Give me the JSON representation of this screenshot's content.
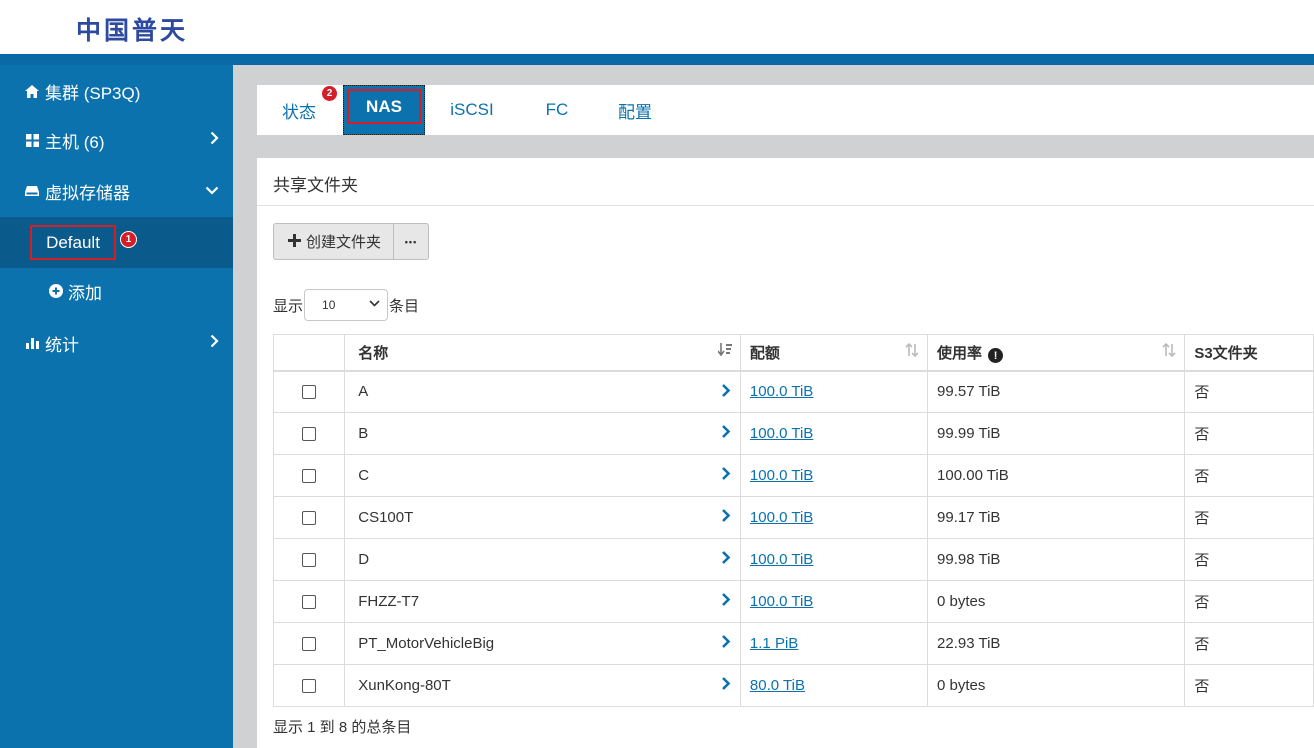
{
  "header": {
    "logo": "中国普天"
  },
  "sidebar": {
    "cluster": {
      "label": "集群 (SP3Q)",
      "icon": "home-icon"
    },
    "hosts": {
      "label": "主机 (6)",
      "icon": "grid-icon"
    },
    "storage": {
      "label": "虚拟存储器",
      "icon": "drive-icon"
    },
    "default": {
      "label": "Default",
      "badge": "1"
    },
    "add": {
      "label": "添加",
      "icon": "plus-circle-icon"
    },
    "stats": {
      "label": "统计",
      "icon": "bar-chart-icon"
    }
  },
  "tabs": {
    "status": "状态",
    "nas": "NAS",
    "iscsi": "iSCSI",
    "fc": "FC",
    "config": "配置",
    "badge": "2"
  },
  "panel": {
    "title": "共享文件夹"
  },
  "toolbar": {
    "create_label": "创建文件夹",
    "more_label": "•••"
  },
  "length": {
    "prefix": "显示",
    "value": "10",
    "suffix": "条目"
  },
  "table": {
    "headers": {
      "name": "名称",
      "quota": "配额",
      "usage": "使用率",
      "s3": "S3文件夹"
    },
    "rows": [
      {
        "name": "A",
        "quota": "100.0 TiB",
        "usage": "99.57 TiB",
        "s3": "否"
      },
      {
        "name": "B",
        "quota": "100.0 TiB",
        "usage": "99.99 TiB",
        "s3": "否"
      },
      {
        "name": "C",
        "quota": "100.0 TiB",
        "usage": "100.00 TiB",
        "s3": "否"
      },
      {
        "name": "CS100T",
        "quota": "100.0 TiB",
        "usage": "99.17 TiB",
        "s3": "否"
      },
      {
        "name": "D",
        "quota": "100.0 TiB",
        "usage": "99.98 TiB",
        "s3": "否"
      },
      {
        "name": "FHZZ-T7",
        "quota": "100.0 TiB",
        "usage": "0 bytes",
        "s3": "否"
      },
      {
        "name": "PT_MotorVehicleBig",
        "quota": "1.1 PiB",
        "usage": "22.93 TiB",
        "s3": "否"
      },
      {
        "name": "XunKong-80T",
        "quota": "80.0 TiB",
        "usage": "0 bytes",
        "s3": "否"
      }
    ]
  },
  "footer": {
    "info": "显示 1 到 8 的总条目"
  },
  "colors": {
    "primary": "#0b72ad",
    "sidebar_active": "#0a5a8c",
    "highlight": "#d51f27"
  }
}
